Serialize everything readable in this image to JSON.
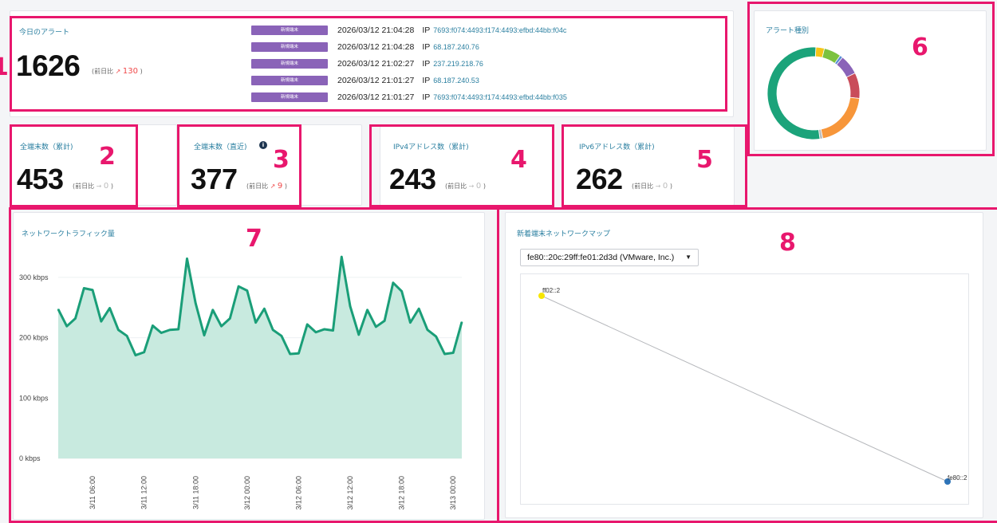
{
  "annotations": [
    "1",
    "2",
    "3",
    "4",
    "5",
    "6",
    "7",
    "8"
  ],
  "alerts_today": {
    "title": "今日のアラート",
    "count": "1626",
    "cmp_prefix": "(前日比",
    "cmp_arrow": "↗",
    "cmp_delta": "130",
    "cmp_suffix": ")",
    "items": [
      {
        "badge": "新規端末",
        "time": "2026/03/12 21:04:28",
        "ip_label": "IP",
        "ip": "7693:f074:4493:f174:4493:efbd:44bb:f04c"
      },
      {
        "badge": "新規端末",
        "time": "2026/03/12 21:04:28",
        "ip_label": "IP",
        "ip": "68.187.240.76"
      },
      {
        "badge": "新規端末",
        "time": "2026/03/12 21:02:27",
        "ip_label": "IP",
        "ip": "237.219.218.76"
      },
      {
        "badge": "新規端末",
        "time": "2026/03/12 21:01:27",
        "ip_label": "IP",
        "ip": "68.187.240.53"
      },
      {
        "badge": "新規端末",
        "time": "2026/03/12 21:01:27",
        "ip_label": "IP",
        "ip": "7693:f074:4493:f174:4493:efbd:44bb:f035"
      }
    ]
  },
  "total_devices": {
    "title": "全端末数（累計)",
    "count": "453",
    "cmp_prefix": "(前日比",
    "cmp_arrow": "→",
    "cmp_delta": "0",
    "cmp_suffix": ")"
  },
  "recent_devices": {
    "title": "全端末数（直近)",
    "count": "377",
    "cmp_prefix": "(前日比",
    "cmp_arrow": "↗",
    "cmp_delta": "9",
    "cmp_suffix": ")",
    "info_icon": "info-icon"
  },
  "ipv4": {
    "title": "IPv4アドレス数（累計)",
    "count": "243",
    "cmp_prefix": "(前日比",
    "cmp_arrow": "→",
    "cmp_delta": "0",
    "cmp_suffix": ")"
  },
  "ipv6": {
    "title": "IPv6アドレス数（累計)",
    "count": "262",
    "cmp_prefix": "(前日比",
    "cmp_arrow": "→",
    "cmp_delta": "0",
    "cmp_suffix": ")"
  },
  "alert_types": {
    "title": "アラート種別",
    "colors": [
      "#f5c518",
      "#7cc23f",
      "#5b8fd6",
      "#8a63b8",
      "#c94c5a",
      "#f7963a",
      "#bbbbbb",
      "#1ba37a"
    ],
    "shares": [
      0.03,
      0.06,
      0.01,
      0.07,
      0.09,
      0.2,
      0.01,
      0.53
    ]
  },
  "traffic": {
    "title": "ネットワークトラフィック量",
    "chart_data": {
      "type": "area",
      "ylabel": "",
      "ylim": [
        0,
        350
      ],
      "yticks": [
        "0 kbps",
        "100 kbps",
        "200 kbps",
        "300 kbps"
      ],
      "ytick_values": [
        0,
        100,
        200,
        300
      ],
      "xticks": [
        "3/11 06:00",
        "3/11 12:00",
        "3/11 18:00",
        "3/12 00:00",
        "3/12 06:00",
        "3/12 12:00",
        "3/12 18:00",
        "3/13 00:00"
      ],
      "xtick_index": [
        4,
        10,
        16,
        22,
        28,
        34,
        40,
        46
      ],
      "values": [
        247,
        219,
        232,
        282,
        279,
        227,
        249,
        213,
        203,
        171,
        176,
        220,
        208,
        213,
        214,
        331,
        257,
        204,
        246,
        219,
        232,
        285,
        278,
        225,
        248,
        213,
        203,
        173,
        174,
        222,
        209,
        214,
        212,
        334,
        252,
        205,
        246,
        218,
        228,
        291,
        277,
        225,
        248,
        213,
        202,
        173,
        175,
        226
      ],
      "colors": {
        "line": "#1a9e78",
        "fill": "#c8eadf"
      }
    }
  },
  "network_map": {
    "title": "新着端末ネットワークマップ",
    "select_value": "fe80::20c:29ff:fe01:2d3d (VMware, Inc.)",
    "caret": "▼",
    "nodes": [
      {
        "label": "ff02::2",
        "color": "#f7e600"
      },
      {
        "label": "fe80::2",
        "color": "#2e74b8"
      }
    ]
  }
}
